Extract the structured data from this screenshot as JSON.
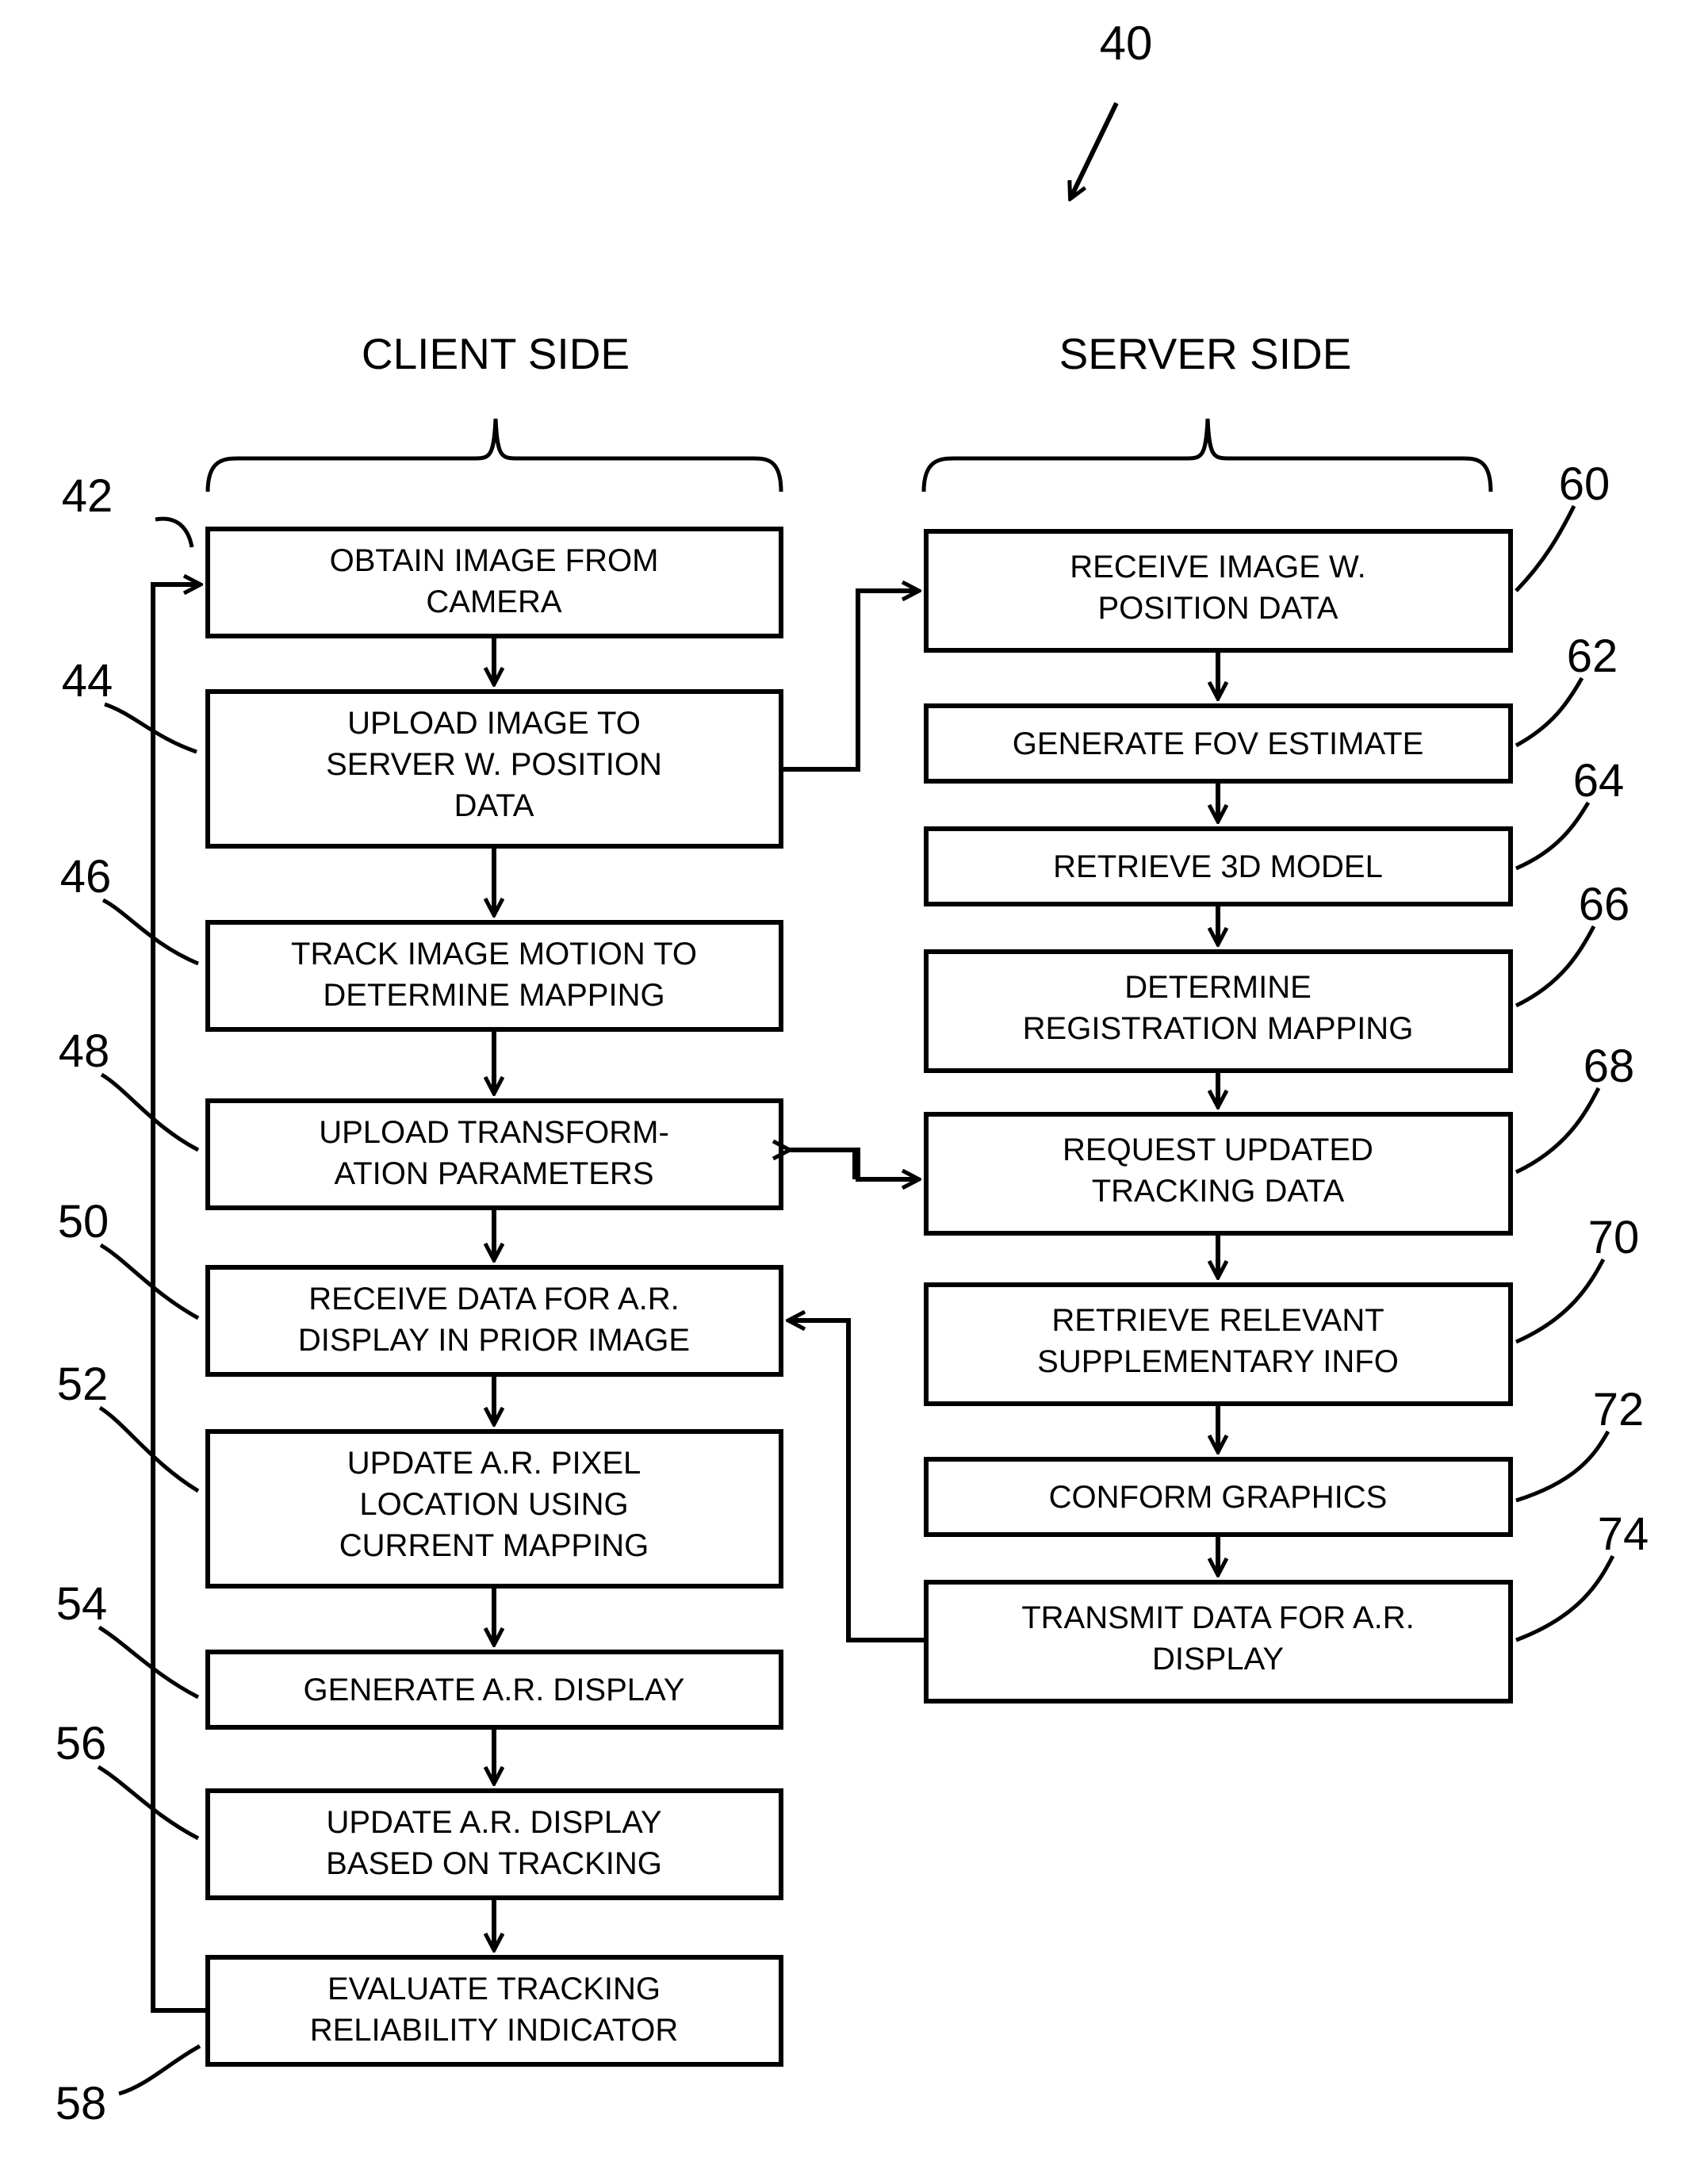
{
  "figure": {
    "number": "40"
  },
  "columns": {
    "client": {
      "header": "CLIENT SIDE"
    },
    "server": {
      "header": "SERVER SIDE"
    }
  },
  "client_steps": [
    {
      "ref": "42",
      "lines": [
        "OBTAIN IMAGE FROM",
        "CAMERA"
      ]
    },
    {
      "ref": "44",
      "lines": [
        "UPLOAD IMAGE TO",
        "SERVER W. POSITION",
        "DATA"
      ]
    },
    {
      "ref": "46",
      "lines": [
        "TRACK IMAGE MOTION TO",
        "DETERMINE MAPPING"
      ]
    },
    {
      "ref": "48",
      "lines": [
        "UPLOAD TRANSFORM-",
        "ATION PARAMETERS"
      ]
    },
    {
      "ref": "50",
      "lines": [
        "RECEIVE DATA FOR A.R.",
        "DISPLAY IN PRIOR IMAGE"
      ]
    },
    {
      "ref": "52",
      "lines": [
        "UPDATE A.R. PIXEL",
        "LOCATION USING",
        "CURRENT MAPPING"
      ]
    },
    {
      "ref": "54",
      "lines": [
        "GENERATE A.R. DISPLAY"
      ]
    },
    {
      "ref": "56",
      "lines": [
        "UPDATE A.R. DISPLAY",
        "BASED ON TRACKING"
      ]
    },
    {
      "ref": "58",
      "lines": [
        "EVALUATE TRACKING",
        "RELIABILITY INDICATOR"
      ]
    }
  ],
  "server_steps": [
    {
      "ref": "60",
      "lines": [
        "RECEIVE IMAGE W.",
        "POSITION DATA"
      ]
    },
    {
      "ref": "62",
      "lines": [
        "GENERATE FOV ESTIMATE"
      ]
    },
    {
      "ref": "64",
      "lines": [
        "RETRIEVE 3D MODEL"
      ]
    },
    {
      "ref": "66",
      "lines": [
        "DETERMINE",
        "REGISTRATION MAPPING"
      ]
    },
    {
      "ref": "68",
      "lines": [
        "REQUEST UPDATED",
        "TRACKING DATA"
      ]
    },
    {
      "ref": "70",
      "lines": [
        "RETRIEVE RELEVANT",
        "SUPPLEMENTARY INFO"
      ]
    },
    {
      "ref": "72",
      "lines": [
        "CONFORM GRAPHICS"
      ]
    },
    {
      "ref": "74",
      "lines": [
        "TRANSMIT DATA FOR A.R.",
        "DISPLAY"
      ]
    }
  ],
  "colors": {
    "ink": "#000000",
    "paper": "#ffffff"
  }
}
